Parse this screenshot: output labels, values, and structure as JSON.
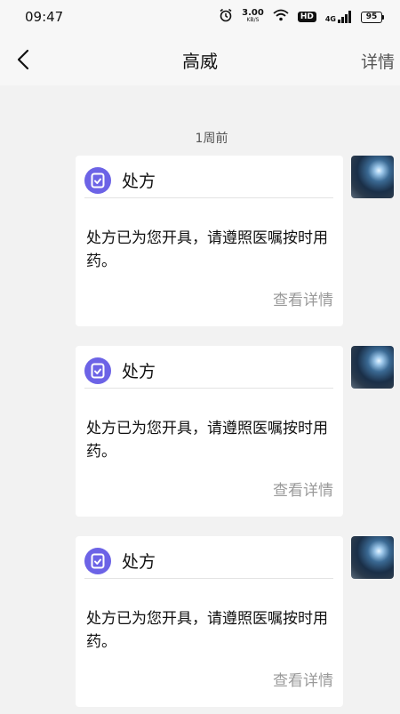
{
  "status_bar": {
    "time": "09:47",
    "speed_value": "3.00",
    "speed_unit": "KB/S",
    "hd": "HD",
    "signal_tag": "4G",
    "battery": "95"
  },
  "header": {
    "title": "高威",
    "detail_label": "详情"
  },
  "timestamp": "1周前",
  "messages": [
    {
      "card_title": "处方",
      "text": "处方已为您开具，请遵照医嘱按时用药。",
      "link": "查看详情"
    },
    {
      "card_title": "处方",
      "text": "处方已为您开具，请遵照医嘱按时用药。",
      "link": "查看详情"
    },
    {
      "card_title": "处方",
      "text": "处方已为您开具，请遵照医嘱按时用药。",
      "link": "查看详情"
    }
  ],
  "icons": {
    "back": "chevron-left-icon",
    "card": "prescription-check-icon",
    "alarm": "alarm-icon",
    "wifi": "wifi-icon",
    "signal": "cell-signal-icon"
  },
  "colors": {
    "accent": "#6c63e6",
    "background": "#f2f2f2",
    "muted_link": "#9a9a9a"
  }
}
